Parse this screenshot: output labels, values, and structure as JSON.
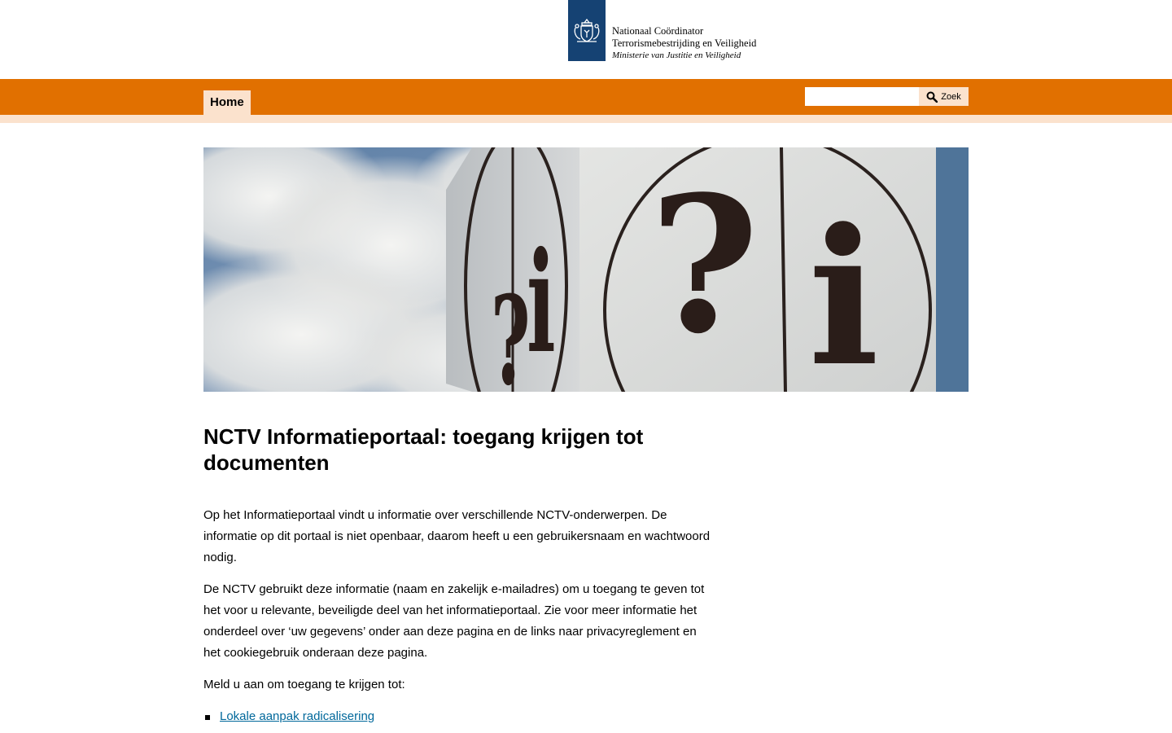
{
  "header": {
    "logo_lines": [
      "Nationaal Coördinator",
      "Terrorismebestrijding en Veiligheid",
      "Ministerie van Justitie en Veiligheid"
    ]
  },
  "nav": {
    "items": [
      {
        "label": "Home"
      }
    ]
  },
  "search": {
    "value": "",
    "button_label": "Zoek"
  },
  "main": {
    "title": "NCTV Informatieportaal: toegang krijgen tot documenten",
    "paragraphs": [
      "Op het Informatieportaal vindt u informatie over verschillende NCTV-onderwerpen. De informatie op dit portaal is niet openbaar, daarom heeft u een gebruikersnaam en wachtwoord nodig.",
      "De NCTV gebruikt deze informatie (naam en zakelijk e-mailadres) om u toegang te geven tot het voor u relevante, beveiligde deel van het informatieportaal. Zie voor meer informatie het onderdeel over ‘uw gegevens’ onder aan deze pagina en de links naar privacyreglement en het cookiegebruik onderaan deze pagina.",
      "Meld u aan om toegang te krijgen tot:"
    ],
    "links": [
      {
        "label": "Lokale aanpak radicalisering"
      }
    ]
  },
  "colors": {
    "brand_orange": "#e17000",
    "light_orange": "#fbe2cd",
    "logo_blue": "#154273",
    "link_blue": "#01689b"
  },
  "icons": [
    "coat-of-arms-icon",
    "search-icon"
  ]
}
